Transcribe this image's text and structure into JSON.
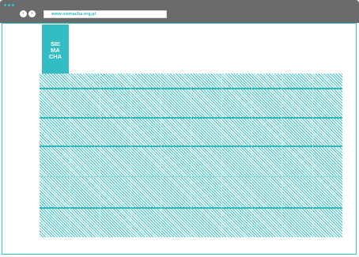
{
  "browser": {
    "url": "www.siemacha.org.pl",
    "back_icon": "chevron-left-icon",
    "forward_icon": "chevron-right-icon",
    "back_glyph": "‹",
    "forward_glyph": "›"
  },
  "logo": {
    "lines": [
      "SIE",
      "MA",
      "CHA"
    ]
  },
  "colors": {
    "accent": "#34c2c8",
    "chrome": "#6b6b6e",
    "pattern_stripe": "#3cc4c8"
  }
}
